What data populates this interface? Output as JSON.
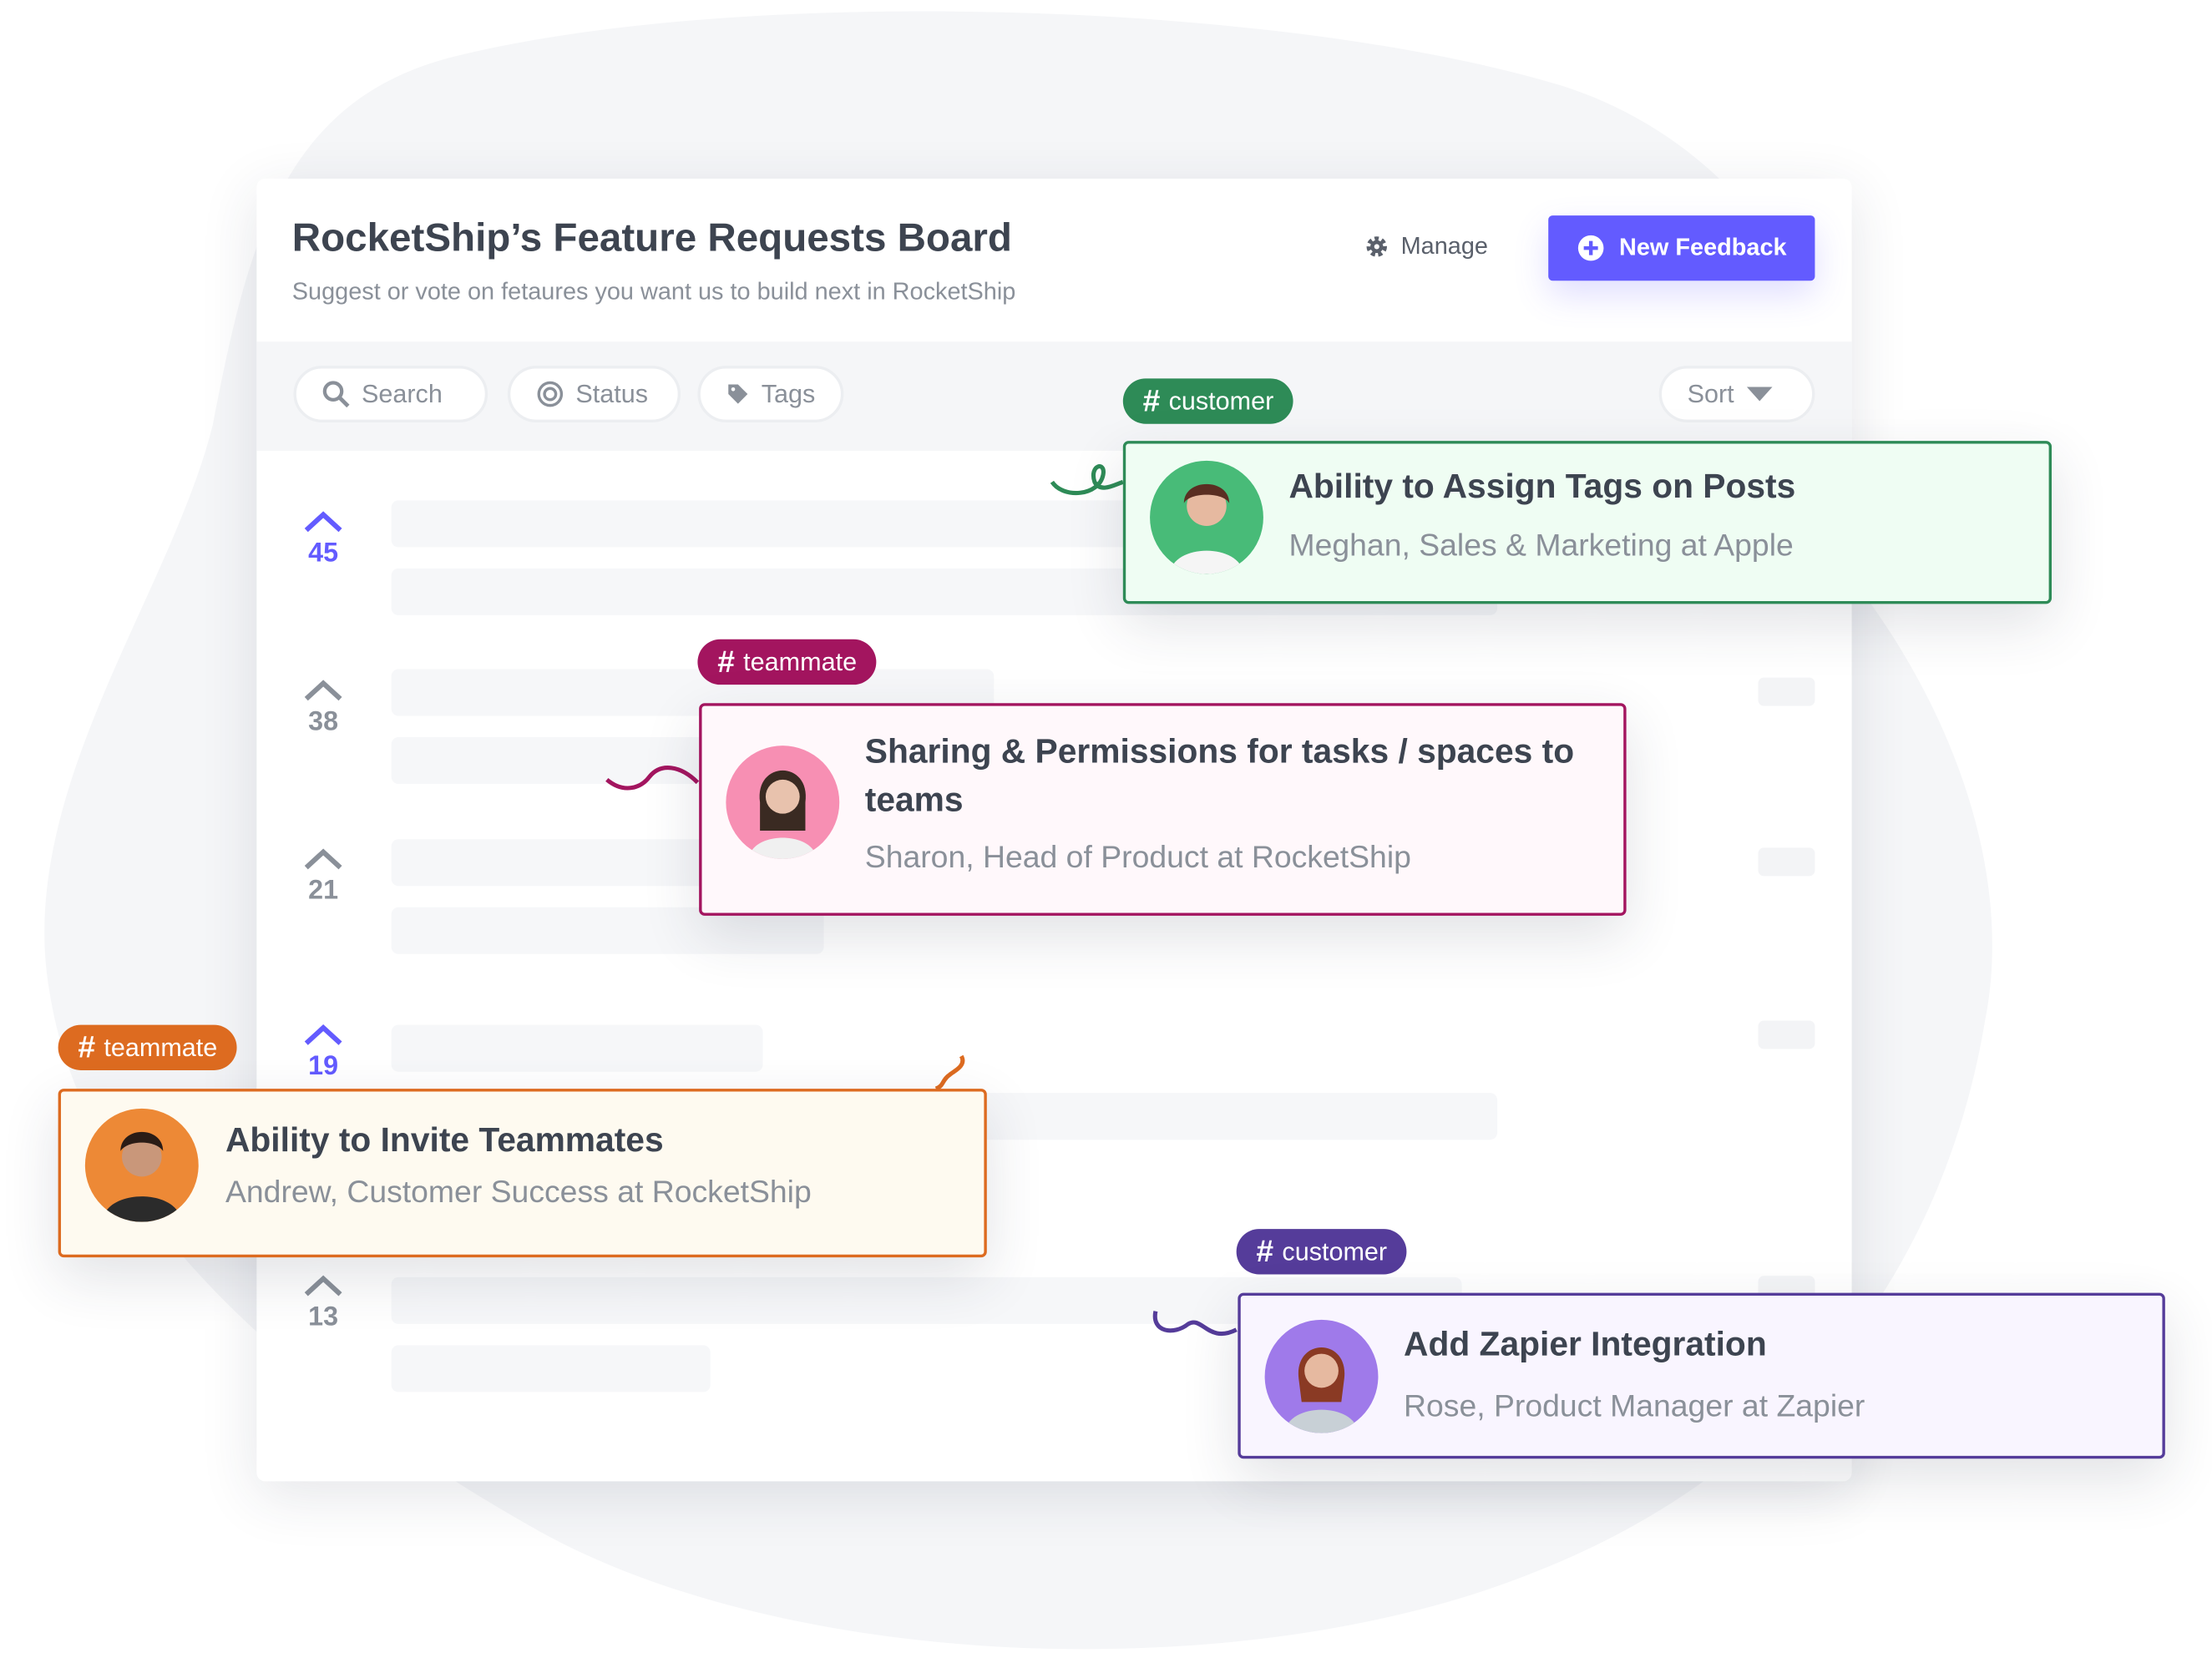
{
  "board": {
    "title": "RocketShip’s Feature Requests Board",
    "subtitle": "Suggest or vote on fetaures you want us to build next in RocketShip",
    "manage_label": "Manage",
    "manage_icon": "gear-icon",
    "new_feedback_label": "New Feedback",
    "new_feedback_icon": "plus-circle-icon",
    "accent_color": "#635bff"
  },
  "filters": {
    "search": "Search",
    "status": "Status",
    "tags": "Tags",
    "sort": "Sort"
  },
  "votes": [
    {
      "count": "45",
      "active": true
    },
    {
      "count": "38",
      "active": false
    },
    {
      "count": "21",
      "active": false
    },
    {
      "count": "19",
      "active": true
    },
    {
      "count": "13",
      "active": false
    }
  ],
  "cards": [
    {
      "tag": "customer",
      "title": "Ability to Assign Tags on Posts",
      "author": "Meghan, Sales & Marketing at Apple",
      "color": "#2e8b57"
    },
    {
      "tag": "teammate",
      "title": "Sharing & Permissions for tasks / spaces to teams",
      "author": "Sharon, Head of Product at RocketShip",
      "color": "#a3155f"
    },
    {
      "tag": "teammate",
      "title": "Ability to Invite Teammates",
      "author": "Andrew, Customer Success at RocketShip",
      "color": "#dd6b20"
    },
    {
      "tag": "customer",
      "title": "Add Zapier Integration",
      "author": "Rose, Product Manager at Zapier",
      "color": "#553c9a"
    }
  ]
}
